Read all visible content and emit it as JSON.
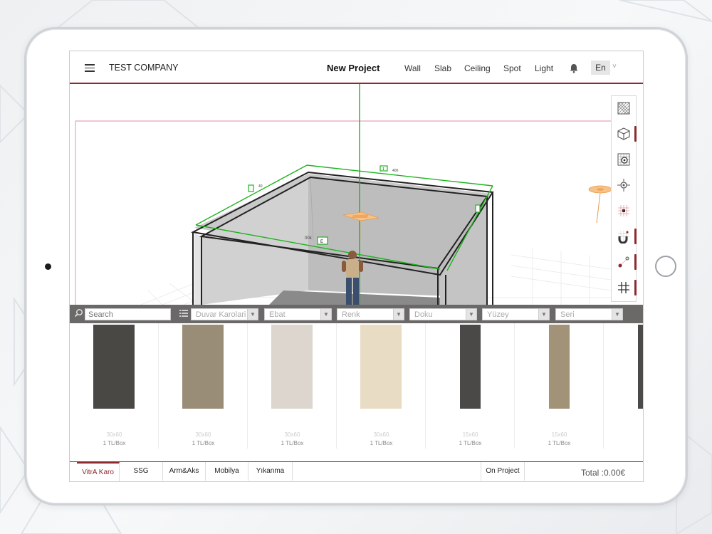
{
  "header": {
    "company": "TEST COMPANY",
    "project_title": "New Project",
    "nav": [
      "Wall",
      "Slab",
      "Ceiling",
      "Spot",
      "Light"
    ],
    "language": "En"
  },
  "viewport": {
    "dim_labels": {
      "back": "400",
      "left": "40",
      "front": "00k",
      "side": "E",
      "top_box": "1"
    }
  },
  "toolbar": {
    "tools": [
      "tile-pattern-icon",
      "cube-icon",
      "texture-settings-icon",
      "target-icon",
      "grid-point-icon",
      "magnet-icon",
      "path-node-icon",
      "hash-grid-icon"
    ]
  },
  "filters": {
    "search_placeholder": "Search",
    "dropdowns": [
      "Duvar Karolari",
      "Ebat",
      "Renk",
      "Doku",
      "Yüzey",
      "Seri"
    ]
  },
  "products": [
    {
      "size": "30x60",
      "price": "1 TL/Box",
      "color": "#4a4845"
    },
    {
      "size": "30x60",
      "price": "1 TL/Box",
      "color": "#9a8d77"
    },
    {
      "size": "30x60",
      "price": "1 TL/Box",
      "color": "#dcd6cf"
    },
    {
      "size": "30x60",
      "price": "1 TL/Box",
      "color": "#e8dcc5"
    },
    {
      "size": "15x60",
      "price": "1 TL/Box",
      "color": "#4b4947"
    },
    {
      "size": "15x60",
      "price": "1 TL/Box",
      "color": "#a19278"
    }
  ],
  "bottom_tabs": [
    "VitrA Karo",
    "SSG",
    "Arm&Aks",
    "Mobilya",
    "Yıkanma"
  ],
  "on_project": "On Project",
  "total": "Total :0.00€",
  "colors": {
    "accent": "#8d2a2e",
    "filter_bar": "#6b6868",
    "dimension_green": "#1db31d"
  }
}
